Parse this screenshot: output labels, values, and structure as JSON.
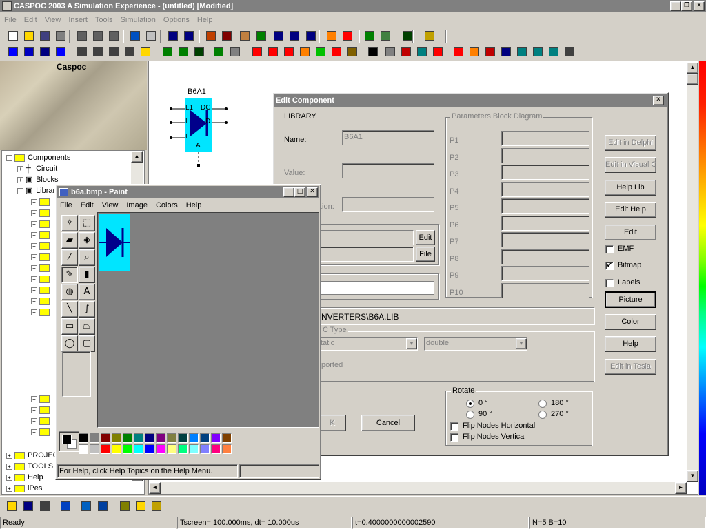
{
  "app": {
    "title": "CASPOC 2003 A Simulation Experience - (untitled) [Modified]",
    "menu": [
      "File",
      "Edit",
      "View",
      "Insert",
      "Tools",
      "Simulation",
      "Options",
      "Help"
    ],
    "logo_text": "Caspoc"
  },
  "schematic": {
    "component_label": "B6A1",
    "pins": {
      "l1": "L1",
      "l2": "L",
      "l3": "L",
      "dc": "DC",
      "d": "D",
      "a": "A"
    }
  },
  "tree": {
    "items": [
      {
        "label": "Components",
        "icon": "folder"
      },
      {
        "label": "Circuit",
        "icon": "circuit-icon"
      },
      {
        "label": "Blocks",
        "icon": "blocks-icon"
      },
      {
        "label": "Library",
        "icon": "library-icon"
      }
    ],
    "bottom_items": [
      {
        "label": "PROJECTS"
      },
      {
        "label": "TOOLS"
      },
      {
        "label": "Help"
      },
      {
        "label": "iPes"
      }
    ]
  },
  "paint": {
    "title": "b6a.bmp - Paint",
    "menu": [
      "File",
      "Edit",
      "View",
      "Image",
      "Colors",
      "Help"
    ],
    "status": "For Help, click Help Topics on the Help Menu.",
    "palette_top": [
      "#000000",
      "#808080",
      "#800000",
      "#808000",
      "#008000",
      "#008080",
      "#000080",
      "#800080",
      "#808040",
      "#004040",
      "#0080ff",
      "#004080",
      "#8000ff",
      "#804000"
    ],
    "palette_bottom": [
      "#ffffff",
      "#c0c0c0",
      "#ff0000",
      "#ffff00",
      "#00ff00",
      "#00ffff",
      "#0000ff",
      "#ff00ff",
      "#ffff80",
      "#00ff80",
      "#80ffff",
      "#8080ff",
      "#ff0080",
      "#ff8040"
    ]
  },
  "dialog": {
    "title": "Edit Component",
    "library_heading": "LIBRARY",
    "name_label": "Name:",
    "name_value": "B6A1",
    "value_label": "Value:",
    "description_label": "tion:",
    "params_title": "Parameters Block Diagram",
    "params": [
      "P1",
      "P2",
      "P3",
      "P4",
      "P5",
      "P6",
      "P7",
      "P8",
      "P9",
      "P10"
    ],
    "edit_btn": "Edit",
    "file_btn": "File",
    "path": "NVERTERS\\B6A.LIB",
    "ctype_title": "C Type",
    "ctype_select1": "tatic",
    "ctype_select2": "double",
    "supported": "ported",
    "ok": "K",
    "cancel": "Cancel",
    "rotate_title": "Rotate",
    "rotate": [
      "0 °",
      "90 °",
      "180 °",
      "270 °"
    ],
    "flip_h": "Flip Nodes Horizontal",
    "flip_v": "Flip Nodes Vertical",
    "side_buttons": {
      "edit_delphi": "Edit in Delphi",
      "edit_visualc": "Edit in Visual C",
      "help_lib": "Help Lib",
      "edit_help": "Edit Help",
      "edit": "Edit",
      "emf": "EMF",
      "bitmap": "Bitmap",
      "labels": "Labels",
      "picture": "Picture",
      "color": "Color",
      "help": "Help",
      "edit_tesla": "Edit in Tesla"
    }
  },
  "statusbar": {
    "ready": "Ready",
    "tscreen": "Tscreen= 100.000ms, dt= 10.000us",
    "time": "t=0.4000000000002590",
    "nodes": "N=5 B=10"
  },
  "colors": {
    "component_fill": "#00e5ff",
    "diode": "#00008b",
    "desktop": "#808080",
    "titlebar_inactive": "#808080"
  }
}
